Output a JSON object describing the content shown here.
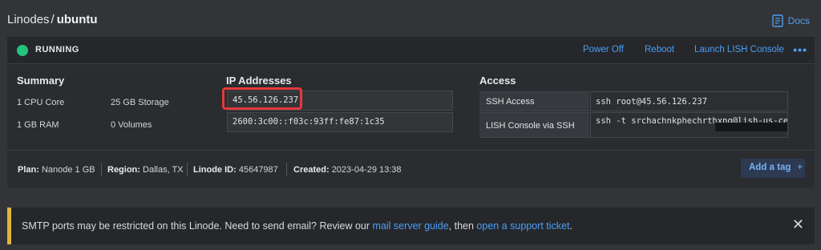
{
  "breadcrumb": {
    "parent": "Linodes",
    "separator": "/",
    "current": "ubuntu"
  },
  "docs": {
    "label": "Docs"
  },
  "status": {
    "label": "RUNNING",
    "color": "#21c47b"
  },
  "actions": {
    "power_off": "Power Off",
    "reboot": "Reboot",
    "launch_lish": "Launch LISH Console",
    "more": "•••"
  },
  "summary": {
    "title": "Summary",
    "cpu": "1 CPU Core",
    "storage": "25 GB Storage",
    "ram": "1 GB RAM",
    "volumes": "0 Volumes"
  },
  "ip": {
    "title": "IP Addresses",
    "ipv4": "45.56.126.237",
    "ipv6": "2600:3c00::f03c:93ff:fe87:1c35"
  },
  "access": {
    "title": "Access",
    "rows": [
      {
        "label": "SSH Access",
        "value": "ssh root@45.56.126.237"
      },
      {
        "label": "LISH Console via SSH",
        "value": "ssh -t srchachnkphechrthxng@lish-us-cent"
      }
    ]
  },
  "footer": {
    "plan_label": "Plan:",
    "plan": "Nanode 1 GB",
    "region_label": "Region:",
    "region": "Dallas, TX",
    "id_label": "Linode ID:",
    "id": "45647987",
    "created_label": "Created:",
    "created": "2023-04-29 13:38",
    "add_tag": "Add a tag",
    "add_tag_icon": "+"
  },
  "notice": {
    "text1": "SMTP ports may be restricted on this Linode. Need to send email? Review our ",
    "link1": "mail server guide",
    "text2": ", then ",
    "link2": "open a support ticket",
    "text3": ".",
    "accent_color": "#e3b43b",
    "close_icon": "✕"
  }
}
